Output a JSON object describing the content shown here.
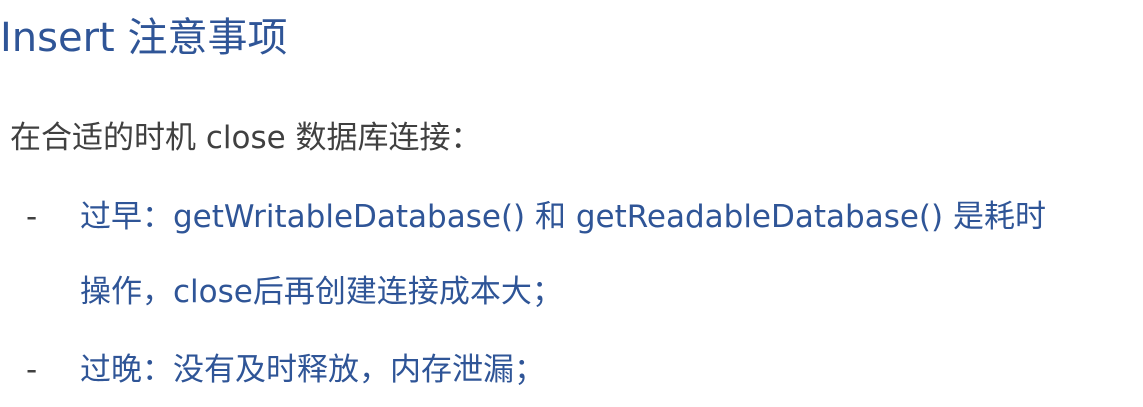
{
  "title": "Insert 注意事项",
  "intro": "在合适的时机 close 数据库连接：",
  "items": [
    {
      "bullet": "-",
      "lines": [
        "过早：getWritableDatabase() 和 getReadableDatabase() 是耗时",
        "操作，close后再创建连接成本大；"
      ]
    },
    {
      "bullet": "-",
      "lines": [
        "过晚：没有及时释放，内存泄漏；"
      ]
    }
  ],
  "colors": {
    "title": "#2f5597",
    "body_text": "#404040",
    "item_text": "#2f5597",
    "background": "#ffffff"
  }
}
